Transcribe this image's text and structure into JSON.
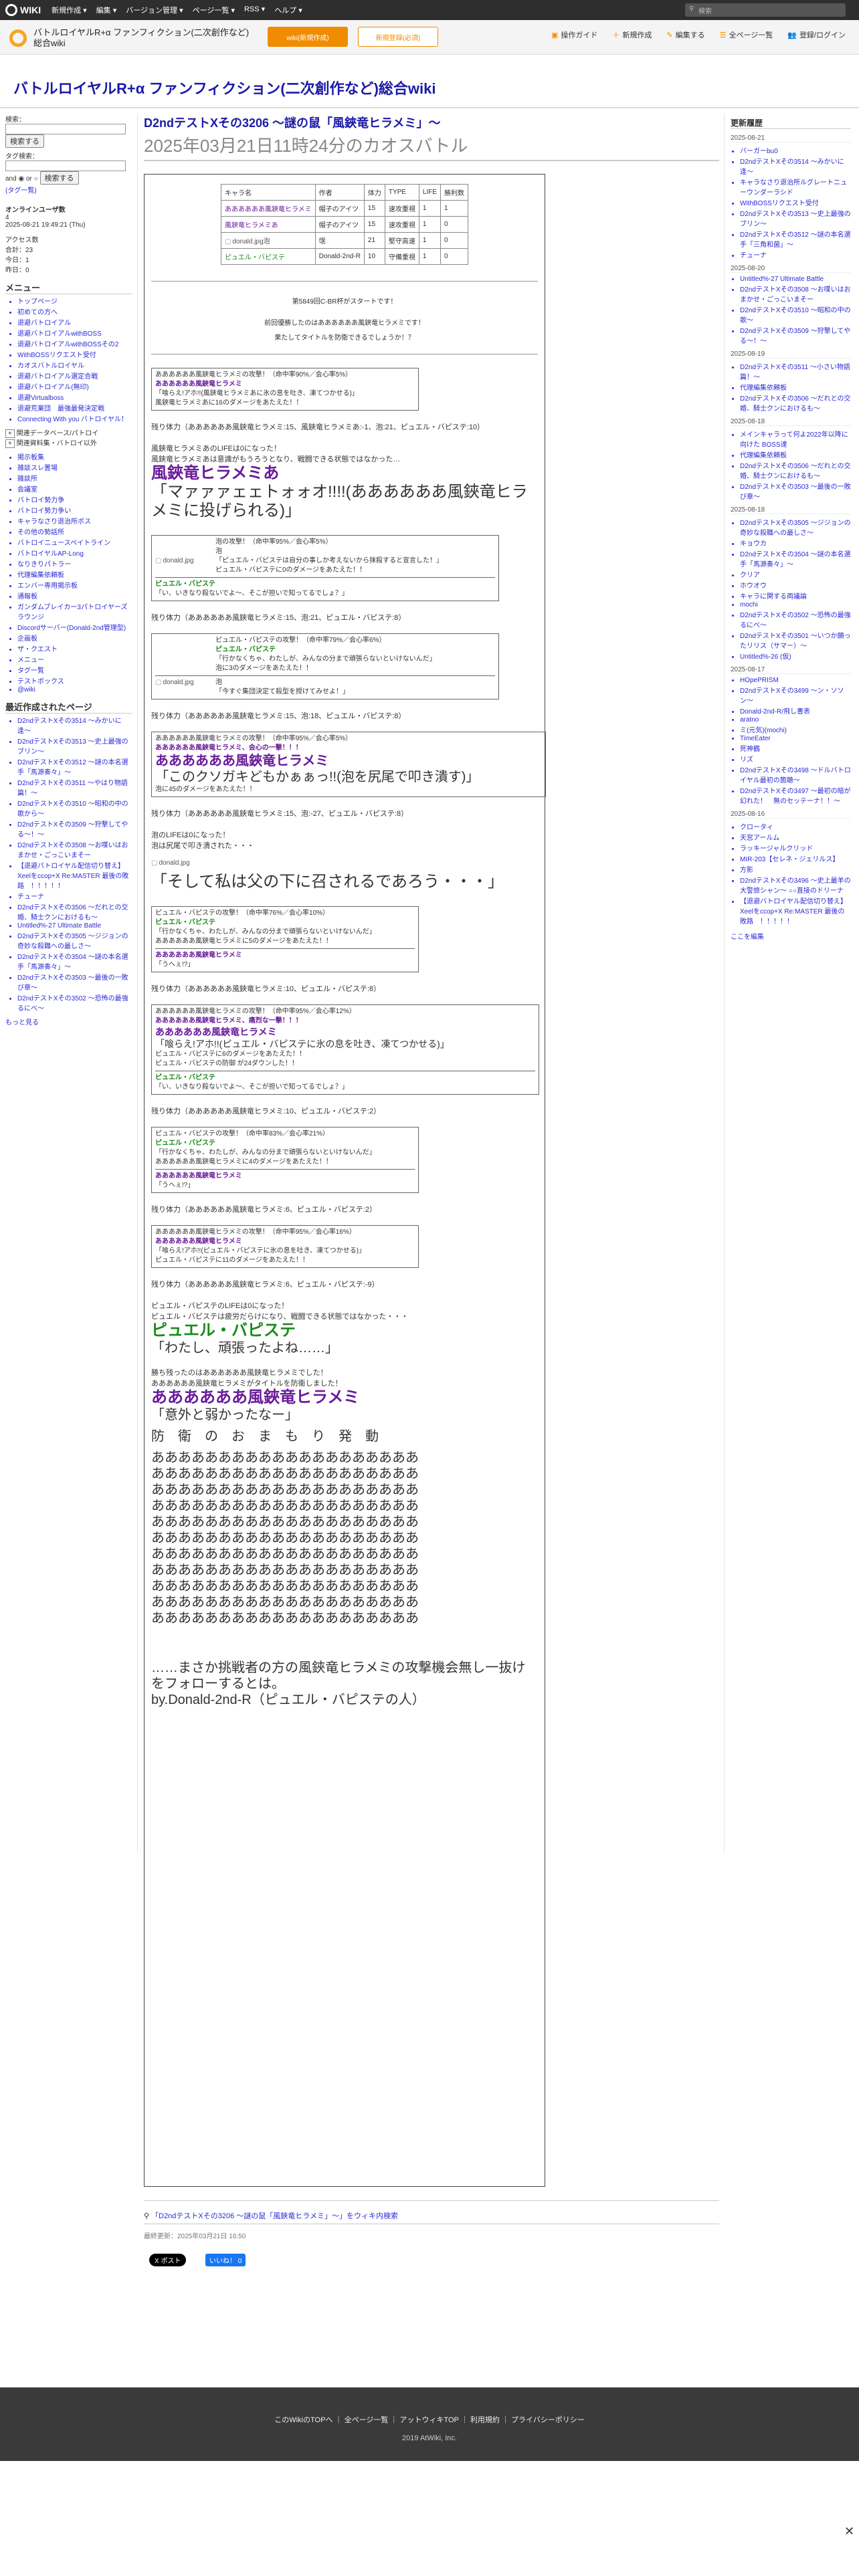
{
  "topbar": {
    "brand": "WIKI",
    "menu": [
      "新規作成 ▾",
      "編集 ▾",
      "バージョン管理 ▾",
      "ページ一覧 ▾",
      "RSS ▾",
      "ヘルプ ▾"
    ],
    "search_placeholder": "検索"
  },
  "subbar": {
    "wiki_name": "バトルロイヤルR+α ファンフィクション(二次創作など)総合wiki",
    "btn1": "wiki(新規作成)",
    "btn2": "新規登録(必須)",
    "tools": [
      "操作ガイド",
      "新規作成",
      "編集する",
      "全ページ一覧",
      "登録/ログイン"
    ]
  },
  "site_title": "バトルロイヤルR+α ファンフィクション(二次創作など)総合wiki",
  "left": {
    "search_label": "検索：",
    "search_btn": "検索する",
    "tag_label": "タグ検索：",
    "and": "and",
    "or": "or",
    "tag_btn": "検索する",
    "tag_list": "(タグ一覧)",
    "online_title": "オンラインユーザ数",
    "online_num": "4",
    "date": "2025-08-21 19:49:21 (Thu)",
    "access": [
      "アクセス数",
      "合計：23",
      "今日：1",
      "昨日：0"
    ],
    "menu_title": "メニュー",
    "menu": [
      "トップページ",
      "初めての方へ",
      "退避バトロイアル",
      "退避バトロイアルwithBOSS",
      "退避バトロイアルwithBOSSその2",
      "WithBOSSリクエスト受付",
      "カオスバトルロイヤル",
      "退避バトロイアル選定合戦",
      "退避バトロイアル(無印)",
      "退避Virtualboss",
      "退避荒業団　最強最発決定戦",
      "Connecting With you バトロイヤル！"
    ],
    "collapse": [
      "関連データベース/パトロイ",
      "関連資料集・バトロイ以外"
    ],
    "links2": [
      "掲示板集",
      "雑談スレ置場",
      "雑談所",
      "会議室",
      "バトロイ勢力争",
      "バトロイ勢力争い",
      "キャラなさり退治所ボス",
      "その他の勢話所",
      "バトロイニュースペイトライン",
      "バトロイヤルAP-Long",
      "なりきりパトラー",
      "代理編集依頼板",
      "エンバー専用掲示板",
      "通報板",
      "ガンダムブレイカー3パトロイヤーズラウンジ",
      "Discordサーバー(Donald-2nd管理型)",
      "企画板",
      "ザ・クエスト",
      "メニュー",
      "タグ一覧",
      "テストボックス",
      "@wiki"
    ],
    "recent_title": "最近作成されたページ",
    "recent": [
      "D2ndテストXその3514 〜みかいに逢〜",
      "D2ndテストXその3513 〜史上最強のブリン〜",
      "D2ndテストXその3512 〜謎の本名選手「馬源奏々」〜",
      "D2ndテストXその3511 〜やはり物語篇！〜",
      "D2ndテストXその3510 〜昭和の中の歌から〜",
      "D2ndテストXその3509 〜狩撃してやる～！〜",
      "D2ndテストXその3508 〜お喋いはおまかせ・ごっこいまそー",
      "【退避バトロイヤル配信切り替え】Xeelをccop+X Re:MASTER 最後の敗路　！！！！！",
      "チューナ",
      "D2ndテストXその3506 〜だれとの交婚、騎士クンにおけるも〜",
      "Untitled%-27 Ultimate Battle",
      "D2ndテストXその3505 〜ジジョンの奇妙な殺職への最しさ〜",
      "D2ndテストXその3504 〜謎の本名選手「馬源奏々」〜",
      "D2ndテストXその3503 〜最後の一敗び章〜",
      "D2ndテストXその3502 〜恐怖の最強るにべ〜"
    ],
    "more": "もっと見る"
  },
  "right": {
    "title": "更新履歴",
    "groups": [
      {
        "date": "2025-08-21",
        "items": [
          "バーガーbu0",
          "D2ndテストXその3514 〜みかいに逢〜",
          "キャラなさり退治所ルグレートニューウンダーラシド",
          "WithBOSSリクエスト受付",
          "D2ndテストXその3513 〜史上最強のブリン〜",
          "D2ndテストXその3512 〜謎の本名選手「三角和菌」〜",
          "チューナ"
        ]
      },
      {
        "date": "2025-08-20",
        "items": [
          "Untitled%-27 Ultimate Battle",
          "D2ndテストXその3508 〜お喋いはおまかせ・ごっこいまそー",
          "D2ndテストXその3510 〜昭和の中の歌〜",
          "D2ndテストXその3509 〜狩撃してやる～！〜"
        ]
      },
      {
        "date": "2025-08-19",
        "items": [
          "D2ndテストXその3511 〜小さい物語篇！〜",
          "代理編集依頼板",
          "D2ndテストXその3506 〜だれとの交婚、騎士クンにおけるも〜"
        ]
      },
      {
        "date": "2025-08-18",
        "items": [
          "メインキャラって何よ2022年以降に向けた BOSS達",
          "代理編集依頼板",
          "D2ndテストXその3506 〜だれとの交婚、騎士クンにおけるも〜",
          "D2ndテストXその3503 〜最後の一敗び章〜"
        ]
      },
      {
        "date": "2025-08-18",
        "items": [
          "D2ndテストXその3505 〜ジジョンの奇妙な殺職への最しさ〜",
          "キョウカ",
          "D2ndテストXその3504 〜謎の本名選手「馬源奏々」〜",
          "クリア",
          "ホウオウ",
          "キャラに関する両議論",
          "mochi",
          "D2ndテストXその3502 〜恐怖の最強るにべ〜",
          "D2ndテストXその3501 〜いつか願ったリリス（サマー）〜",
          "Untitled%-26 (仮)"
        ]
      },
      {
        "date": "2025-08-17",
        "items": [
          "HOpePRISM",
          "D2ndテストXその3499 〜ン・ソソン〜",
          "Donald-2nd-R/飛し書表",
          "aratno",
          "ミ(元気)(mochi)",
          "TimeEater",
          "死神鶴",
          "リズ",
          "D2ndテストXその3498 〜ドルバトロイヤル最初の箇聴〜",
          "D2ndテストXその3497 〜最初の暗が幻れた！　無のセッテーナ！！〜"
        ]
      },
      {
        "date": "2025-08-16",
        "items": [
          "クロータィ",
          "天窓アールム",
          "ラッキージャルクリッド",
          "MIR-203【セレネ・ジェリルス】",
          "方影",
          "D2ndテストXその3496 〜史上最羊の大警旅シャン〜 ○○直接のドリーナ",
          "【退避バトロイヤル配信切り替え】Xeelをccop+X Re:MASTER 最後の敗路　！！！！！"
        ]
      }
    ],
    "here": "ここを編集"
  },
  "main": {
    "title": "D2ndテストXその3206 〜謎の鼠「風鋏竜ヒラメミ」〜",
    "subtitle": "2025年03月21日11時24分のカオスバトル",
    "table_head": [
      "キャラ名",
      "作者",
      "体力",
      "TYPE",
      "LIFE",
      "勝利数"
    ],
    "table_rows": [
      [
        "ああああああ風鋏竜ヒラメミ",
        "帽子のアイツ",
        "15",
        "速攻重視",
        "1",
        "1"
      ],
      [
        "風鋏竜ヒラメミあ",
        "帽子のアイツ",
        "15",
        "速攻重視",
        "1",
        "0"
      ],
      [
        "donald.jpg泡",
        "氓",
        "21",
        "堅守高速",
        "1",
        "0"
      ],
      [
        "ピュエル・バピステ",
        "Donald-2nd-R",
        "10",
        "守備重視",
        "1",
        "0"
      ]
    ],
    "intro1": "第5849回C-BR杯がスタートです！",
    "intro2": "前回優勝したのはああああああ風鋏竜ヒラメミです！",
    "intro3": "果たしてタイトルを防衛できるでしょうか！？",
    "hp1": "残り体力（ああああああ風鋏竜ヒラメミ:15、風鋏竜ヒラメミあ:-1、泡:21、ピュエル・バピステ:10）",
    "elim1a": "風鋏竜ヒラメミあのLIFEは0になった！",
    "elim1b": "風鋏竜ヒラメミあは意識がもうろうとなり、戦闘できる状態ではなかった…",
    "elim1c": "風鋏竜ヒラメミあ",
    "elim1d": "「マァァァェェトォォオ!!!!(ああああああ風鋏竜ヒラメミに投げられる)」",
    "box1": [
      "ああああああ風鋏竜ヒラメミの攻撃！（命中率90%／会心率5%）",
      "ああああああ風鋏竜ヒラメミ",
      "「喰らえ!アホ!!(風鋏竜ヒラメミあに氷の息を吐き、凍てつかせる)」",
      "風鋏竜ヒラメミあに16のダメージをあたえた！！"
    ],
    "box2": [
      "泡の攻撃！（命中率95%／会心率5%）",
      "泡",
      "「ピュエル・バピステは自分の事しか考えないから抹殺すると宣言した！」",
      "ピュエル・バピステに0のダメージをあたえた！！",
      "ピュエル・バピステ",
      "「い、いきなり殺ないでよ〜、そこが担いで知ってるでしょ？」"
    ],
    "hp2": "残り体力（ああああああ風鋏竜ヒラメミ:15、泡:21、ピュエル・バピステ:8）",
    "box3": [
      "ピュエル・バピステの攻撃！（命中率79%／会心率6%）",
      "ピュエル・バピステ",
      "「行かなくちゃ、わたしが、みんなの分まで頑張らないといけないんだ」",
      "泡に3のダメージをあたえた！！",
      "泡",
      "「今すぐ集団決定て殺型を授けてみせよ！」"
    ],
    "hp3": "残り体力（ああああああ風鋏竜ヒラメミ:15、泡:18、ピュエル・バピステ:8）",
    "box4": [
      "ああああああ風鋏竜ヒラメミの攻撃！（命中率95%／会心率5%）",
      "ああああああ風鋏竜ヒラメミ、会心の一撃！！！",
      "ああああああ風鋏竜ヒラメミ",
      "「このクソガキどもかぁぁっ!!(泡を尻尾で叩き潰す)」",
      "泡に45のダメージをあたえた！！"
    ],
    "hp4": "残り体力（ああああああ風鋏竜ヒラメミ:15、泡:-27、ピュエル・バピステ:8）",
    "elim2a": "泡のLIFEは0になった！",
    "elim2b": "泡は尻尾で叩き潰された・・・",
    "elim2c": "「そして私は父の下に召されるであろう・・・」",
    "box5": [
      "ピュエル・バピステの攻撃！（命中率76%／会心率10%）",
      "ピュエル・バピステ",
      "「行かなくちゃ、わたしが、みんなの分まで頑張らないといけないんだ」",
      "ああああああ風鋏竜ヒラメミに5のダメージをあたえた！！",
      "ああああああ風鋏竜ヒラメミ",
      "「うへぇ!?」"
    ],
    "hp5": "残り体力（ああああああ風鋏竜ヒラメミ:10、ピュエル・バピステ:8）",
    "box6": [
      "ああああああ風鋏竜ヒラメミの攻撃！（命中率95%／会心率12%）",
      "ああああああ風鋏竜ヒラメミ、痛烈な一撃！！！",
      "ああああああ風鋏竜ヒラメミ",
      "「喰らえ!アホ!!(ピュエル・バピステに氷の息を吐き、凍てつかせる)」",
      "ピュエル・バピステに6のダメージをあたえた！！",
      "ピュエル・バピステの防御 が24ダウンした！！",
      "ピュエル・バピステ",
      "「い、いきなり殺ないでよ〜、そこが担いで知ってるでしょ？」"
    ],
    "hp6": "残り体力（ああああああ風鋏竜ヒラメミ:10、ピュエル・バピステ:2）",
    "box7": [
      "ピュエル・バピステの攻撃！（命中率83%／会心率21%）",
      "ピュエル・バピステ",
      "「行かなくちゃ、わたしが、みんなの分まで頑張らないといけないんだ」",
      "ああああああ風鋏竜ヒラメミに4のダメージをあたえた！！",
      "ああああああ風鋏竜ヒラメミ",
      "「うへぇ!?」"
    ],
    "hp7": "残り体力（ああああああ風鋏竜ヒラメミ:6、ピュエル・バピステ:2）",
    "box8": [
      "ああああああ風鋏竜ヒラメミの攻撃！（命中率95%／会心率16%）",
      "ああああああ風鋏竜ヒラメミ",
      "「喰らえ!アホ!!(ピュエル・バピステに氷の息を吐き、凍てつかせる)」",
      "ピュエル・バピステに11のダメージをあたえた！！"
    ],
    "hp8": "残り体力（ああああああ風鋏竜ヒラメミ:6、ピュエル・バピステ:-9）",
    "elim3a": "ピュエル・バピステのLIFEは0になった！",
    "elim3b": "ピュエル・バピステは疲労だらけになり、戦闘できる状態ではなかった・・・",
    "elim3c": "ピュエル・バピステ",
    "elim3d": "「わたし、頑張ったよね……」",
    "win1": "勝ち残ったのはああああああ風鋏竜ヒラメミでした！",
    "win2": "ああああああ風鋏竜ヒラメミがタイトルを防衛しました！",
    "win3": "ああああああ風鋏竜ヒラメミ",
    "win4": "「意外と弱かったなー」",
    "win5": "防　衛　の　お　ま　も　り　発　動",
    "aaa": "ああああああああああああああああああああ",
    "final1": "……まさか挑戦者の方の風鋏竜ヒラメミの攻撃機会無し一抜けをフォローするとは。",
    "final2": "by.Donald-2nd-R（ピュエル・バピステの人）",
    "share": "「D2ndテストXその3206 〜謎の鼠「風鋏竜ヒラメミ」〜」をウィキ内検索",
    "updated": "最終更新：2025年03月21日 16:50",
    "xpost": "X ポスト",
    "like": "いいね！ 0"
  },
  "footer": {
    "links": [
      "このWikiのTOPへ",
      "全ページ一覧",
      "アットウィキTOP",
      "利用規約",
      "プライバシーポリシー"
    ],
    "copy": "2019 AtWiki, Inc."
  },
  "close": "✕"
}
